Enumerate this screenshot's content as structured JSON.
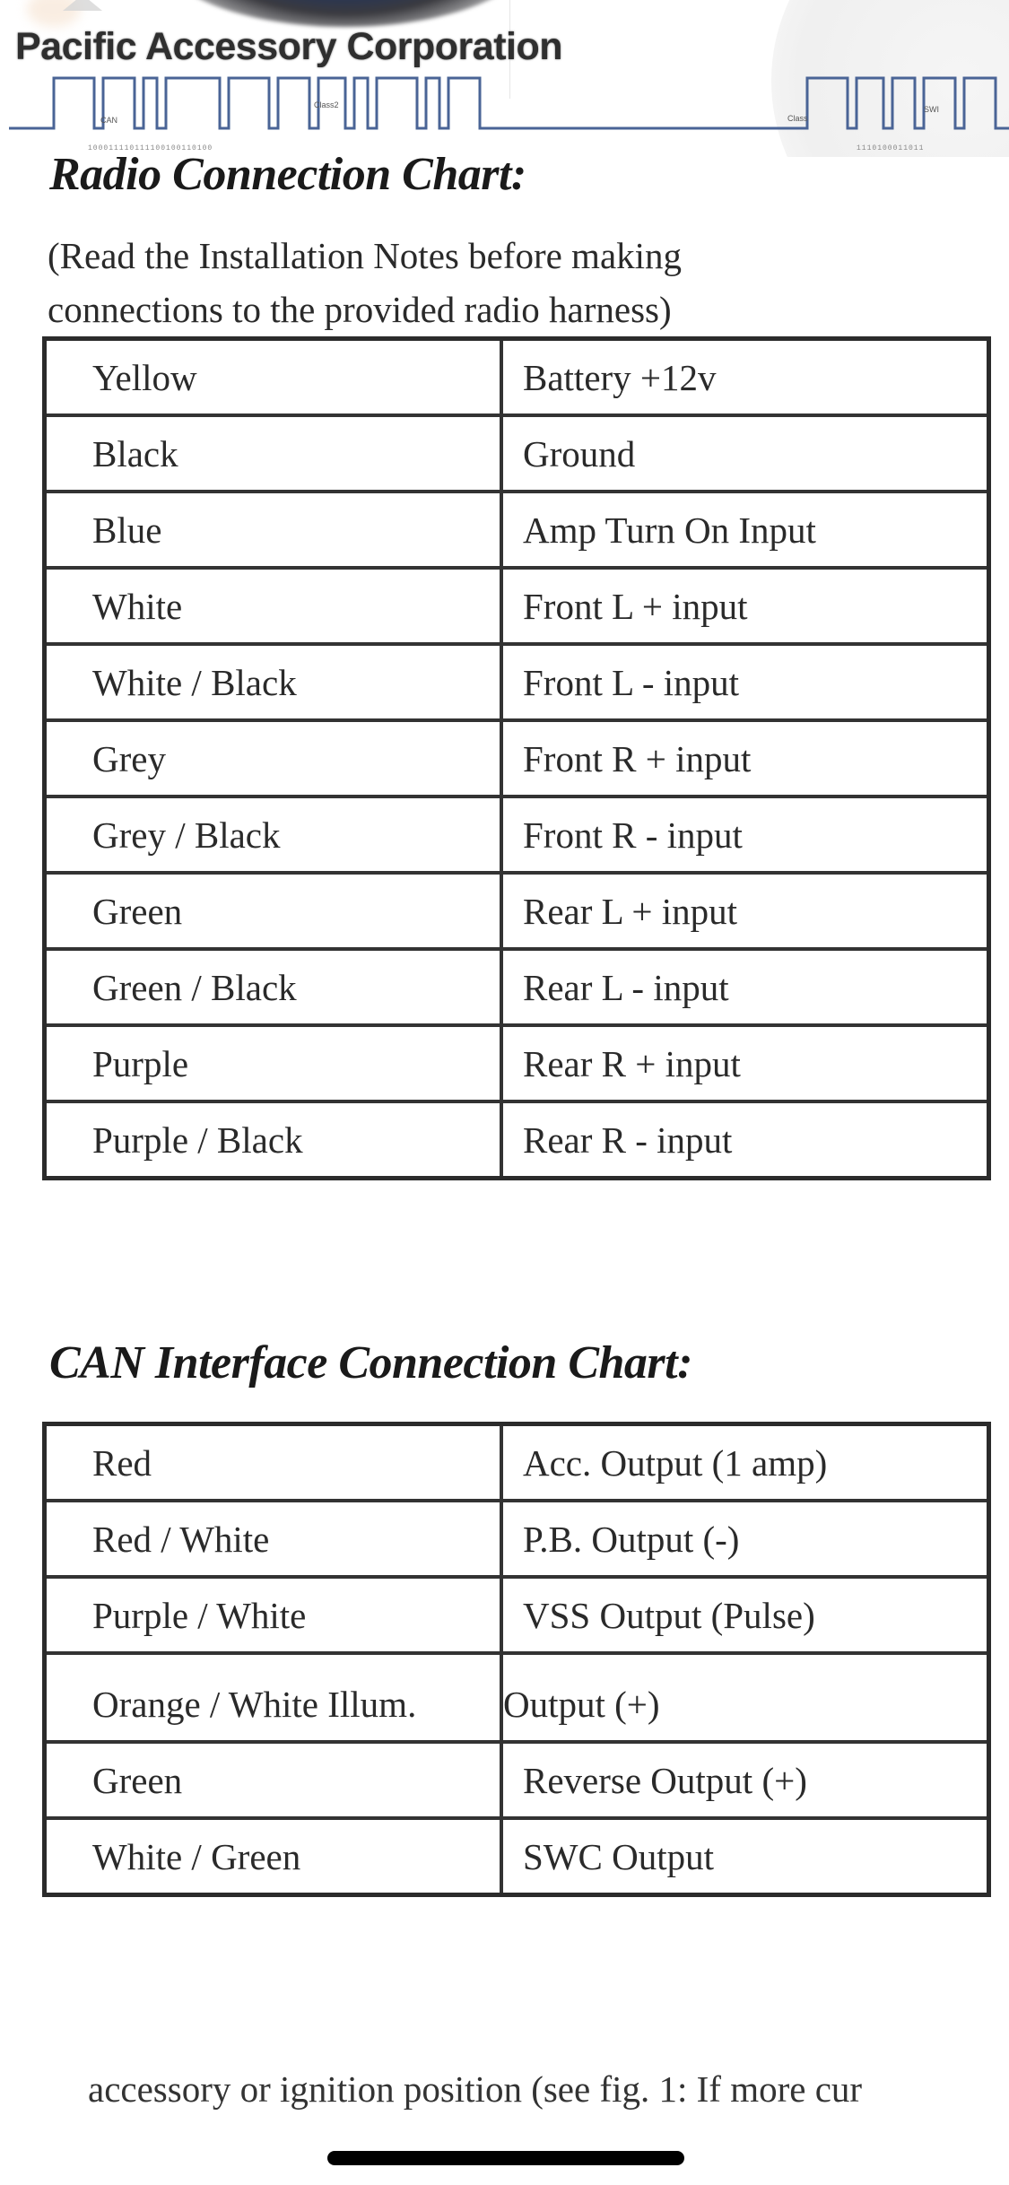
{
  "header": {
    "company_name": "Pacific Accessory Corporation",
    "wave_labels": [
      "CAN",
      "Class2",
      "Class",
      "SWI"
    ],
    "bitstring_left": "100011110111100100110100",
    "bitstring_right": "1110100011011"
  },
  "radio_chart": {
    "title": "Radio Connection Chart:",
    "note_line1": "(Read the Installation Notes before making",
    "note_line2": "connections to the provided radio harness)",
    "rows": [
      {
        "wire": "Yellow",
        "function": "Battery +12v"
      },
      {
        "wire": "Black",
        "function": "Ground"
      },
      {
        "wire": "Blue",
        "function": "Amp Turn On Input"
      },
      {
        "wire": "White",
        "function": "Front L + input"
      },
      {
        "wire": "White / Black",
        "function": "Front L - input"
      },
      {
        "wire": "Grey",
        "function": "Front R + input"
      },
      {
        "wire": "Grey / Black",
        "function": "Front R - input"
      },
      {
        "wire": "Green",
        "function": "Rear L + input"
      },
      {
        "wire": "Green / Black",
        "function": "Rear L - input"
      },
      {
        "wire": "Purple",
        "function": "Rear R + input"
      },
      {
        "wire": "Purple / Black",
        "function": "Rear R - input"
      }
    ]
  },
  "can_chart": {
    "title": "CAN Interface Connection Chart:",
    "rows": [
      {
        "wire": "Red",
        "function": "Acc. Output (1 amp)"
      },
      {
        "wire": "Red / White",
        "function": "P.B. Output (-)"
      },
      {
        "wire": "Purple / White",
        "function": "VSS Output (Pulse)"
      },
      {
        "wire": "Orange / White Illum.",
        "function": "Output (+)"
      },
      {
        "wire": "Green",
        "function": "Reverse Output (+)"
      },
      {
        "wire": "White / Green",
        "function": "SWC Output"
      }
    ]
  },
  "footer": {
    "partial_text": "accessory or ignition position (see fig. 1: If more cur"
  },
  "colors": {
    "wave": "#4a6496",
    "border": "#2b2b2b",
    "text": "#2a2a2a"
  }
}
